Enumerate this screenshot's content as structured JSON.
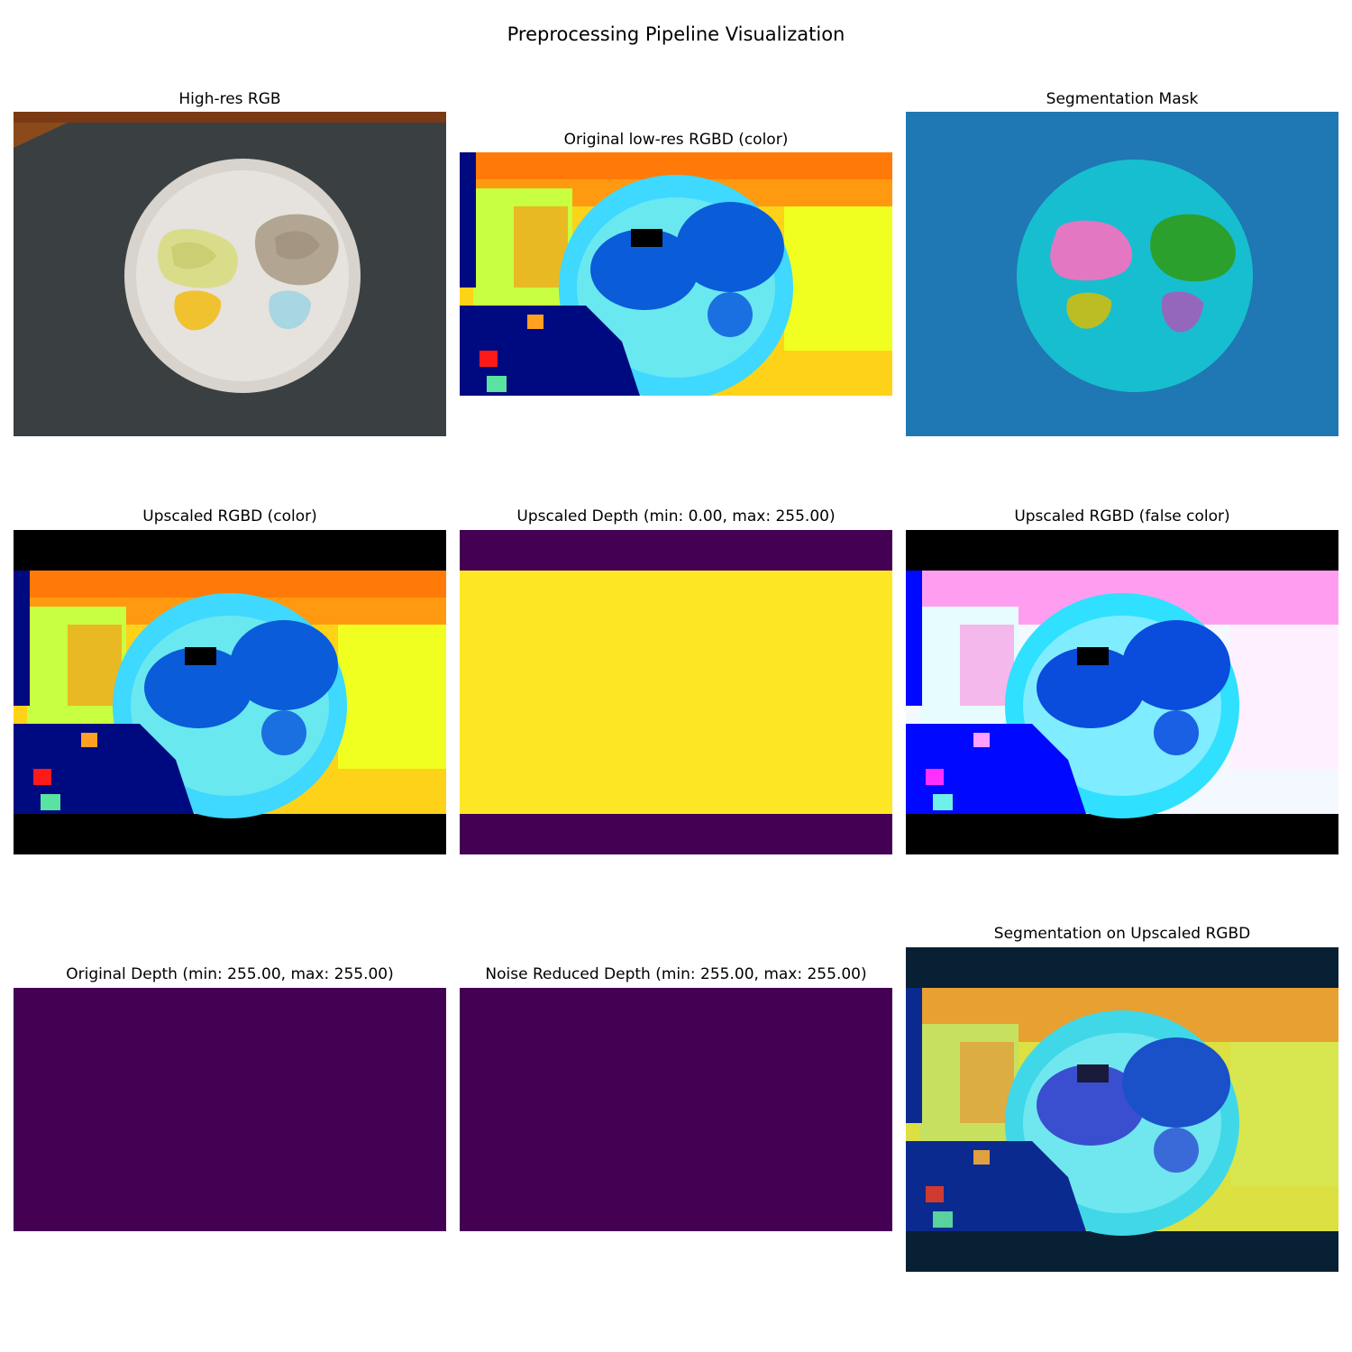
{
  "figure": {
    "title": "Preprocessing Pipeline Visualization"
  },
  "panels": [
    {
      "title": "High-res RGB"
    },
    {
      "title": "Original low-res RGBD (color)"
    },
    {
      "title": "Segmentation Mask"
    },
    {
      "title": "Upscaled RGBD (color)"
    },
    {
      "title": "Upscaled Depth (min: 0.00, max: 255.00)"
    },
    {
      "title": "Upscaled RGBD (false color)"
    },
    {
      "title": "Original Depth (min: 255.00, max: 255.00)"
    },
    {
      "title": "Noise Reduced Depth (min: 255.00, max: 255.00)"
    },
    {
      "title": "Segmentation on Upscaled RGBD"
    }
  ],
  "colors": {
    "viridis_low": "#440154",
    "viridis_high": "#fde725",
    "mask_background": "#1f77b4",
    "mask_plate": "#17becf",
    "mask_pink": "#e377c2",
    "mask_green": "#2ca02c",
    "mask_olive": "#bcbd22",
    "mask_purple": "#9467bd",
    "letterbox_black": "#000000",
    "overlay_letterbox": "#082033"
  }
}
